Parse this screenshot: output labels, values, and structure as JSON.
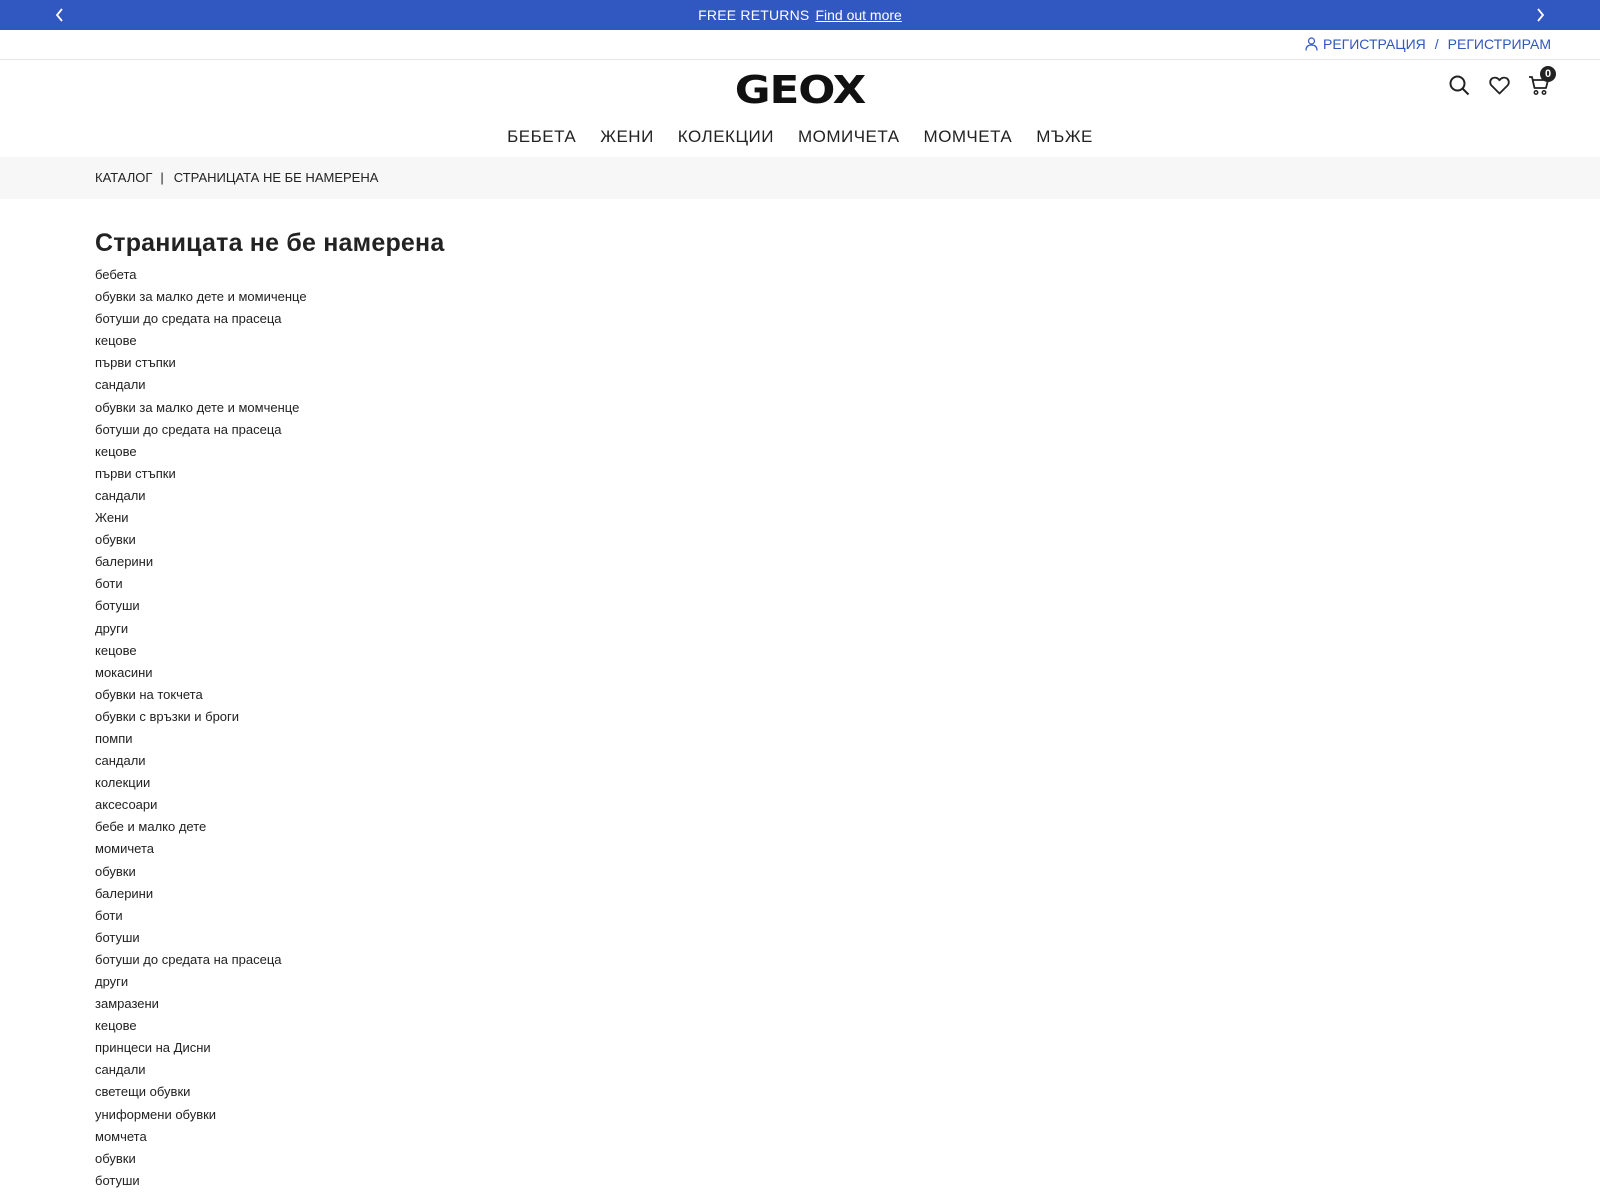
{
  "promo": {
    "text": "FREE RETURNS",
    "link": "Find out more"
  },
  "account": {
    "register": "РЕГИСТРАЦИЯ",
    "separator": "/",
    "signup": "РЕГИСТРИРАМ"
  },
  "logo": "GEOX",
  "cart": {
    "count": "0"
  },
  "nav": {
    "items": [
      "БЕБЕТА",
      "ЖЕНИ",
      "КОЛЕКЦИИ",
      "МОМИЧЕТА",
      "МОМЧЕТА",
      "МЪЖЕ"
    ]
  },
  "breadcrumb": {
    "catalog": "КАТАЛОГ",
    "separator": "|",
    "current": "СТРАНИЦАТА НЕ БЕ НАМЕРЕНА"
  },
  "page": {
    "title": "Страницата не бе намерена"
  },
  "categories": [
    "бебета",
    "обувки за малко дете и момиченце",
    "ботуши до средата на прасеца",
    "кецове",
    "първи стъпки",
    "сандали",
    "обувки за малко дете и момченце",
    "ботуши до средата на прасеца",
    "кецове",
    "първи стъпки",
    "сандали",
    "Жени",
    "обувки",
    "балерини",
    "боти",
    "ботуши",
    "други",
    "кецове",
    "мокасини",
    "обувки на токчета",
    "обувки с връзки и броги",
    "помпи",
    "сандали",
    "колекции",
    "аксесоари",
    "бебе и малко дете",
    "момичета",
    "обувки",
    "балерини",
    "боти",
    "ботуши",
    "ботуши до средата на прасеца",
    "други",
    "замразени",
    "кецове",
    "принцеси на Дисни",
    "сандали",
    "светещи обувки",
    "униформени обувки",
    "момчета",
    "обувки",
    "ботуши"
  ],
  "colors": {
    "promo_bg": "#3157c0",
    "account_link": "#3157c0",
    "breadcrumb_bg": "#f7f7f7"
  },
  "icons": {
    "promo_prev": "chevron-left-icon",
    "promo_next": "chevron-right-icon",
    "account": "user-icon",
    "search": "search-icon",
    "wishlist": "heart-icon",
    "cart": "cart-icon"
  }
}
